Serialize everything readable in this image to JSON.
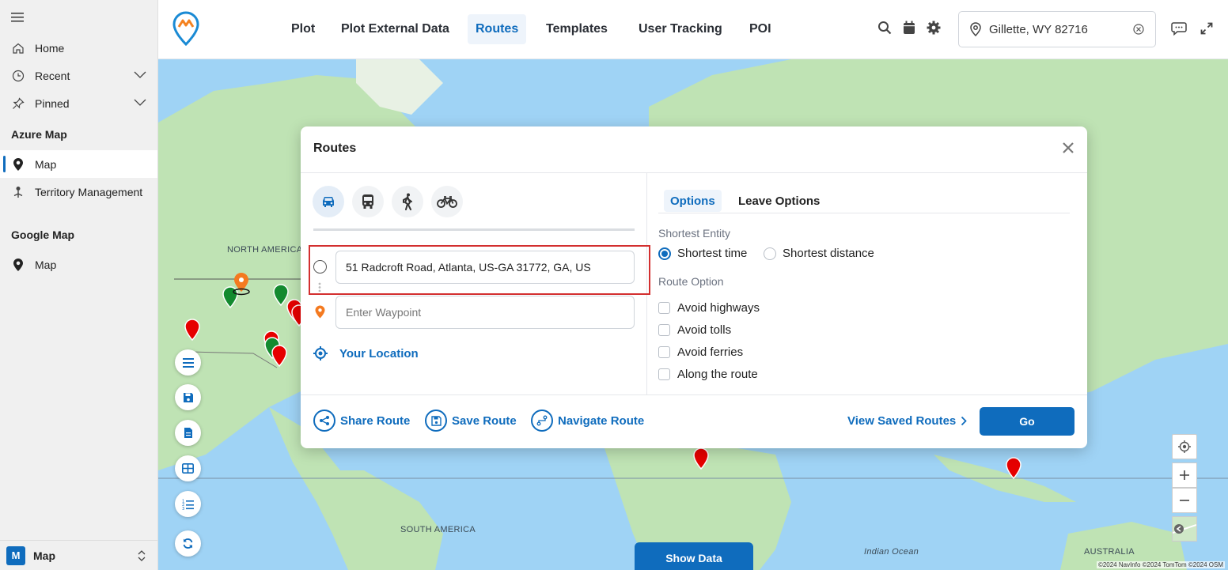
{
  "sidebar": {
    "items": [
      {
        "label": "Home",
        "icon": "home-icon"
      },
      {
        "label": "Recent",
        "icon": "clock-icon"
      },
      {
        "label": "Pinned",
        "icon": "pin-icon"
      }
    ],
    "section_azure": "Azure Map",
    "azure_items": [
      {
        "label": "Map",
        "icon": "map-marker-icon",
        "active": true
      },
      {
        "label": "Territory Management",
        "icon": "territory-icon"
      }
    ],
    "section_google": "Google Map",
    "google_items": [
      {
        "label": "Map",
        "icon": "map-marker-icon"
      }
    ],
    "area": {
      "badge": "M",
      "label": "Map"
    }
  },
  "topbar": {
    "tabs": [
      "Plot",
      "Plot External Data",
      "Routes",
      "Templates",
      "User Tracking",
      "POI"
    ],
    "active_tab": "Routes",
    "location": "Gillette, WY 82716"
  },
  "map": {
    "labels": {
      "north_america": "NORTH AMERICA",
      "south_america": "SOUTH AMERICA",
      "indian_ocean": "Indian Ocean",
      "australia": "AUSTRALIA"
    },
    "attribution": "©2024 NavInfo ©2024 TomTom ©2024 OSM",
    "show_data": "Show Data"
  },
  "dialog": {
    "title": "Routes",
    "travel_modes": [
      "car-icon",
      "bus-icon",
      "walk-icon",
      "bike-icon"
    ],
    "start_value": "51 Radcroft Road, Atlanta, US-GA 31772, GA, US",
    "waypoint_placeholder": "Enter Waypoint",
    "your_location": "Your Location",
    "option_tabs": [
      "Options",
      "Leave Options"
    ],
    "shortest_entity_label": "Shortest Entity",
    "shortest_options": [
      "Shortest time",
      "Shortest distance"
    ],
    "route_option_label": "Route Option",
    "route_options": [
      "Avoid highways",
      "Avoid tolls",
      "Avoid ferries",
      "Along the route"
    ],
    "footer": {
      "share": "Share Route",
      "save": "Save Route",
      "navigate": "Navigate Route",
      "view_saved": "View Saved Routes",
      "go": "Go"
    }
  },
  "colors": {
    "accent": "#0f6cbd",
    "highlight": "#d32f2f",
    "ocean": "#9fd3f5",
    "land": "#bfe3b4"
  }
}
